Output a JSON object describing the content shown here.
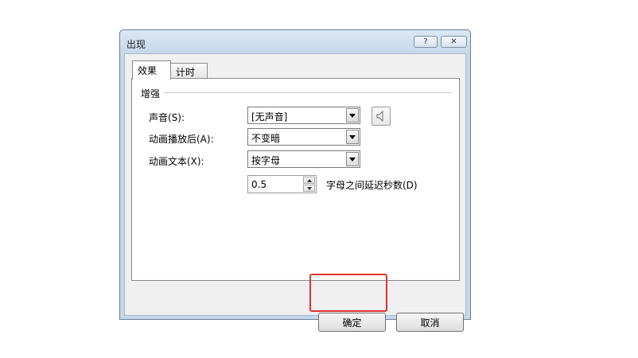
{
  "dialog": {
    "title": "出现",
    "help_glyph": "?",
    "close_glyph": "✕"
  },
  "tabs": [
    {
      "label": "效果",
      "active": true
    },
    {
      "label": "计时",
      "active": false
    }
  ],
  "group": {
    "title": "增强"
  },
  "fields": {
    "sound_label": "声音(S):",
    "sound_value": "[无声音]",
    "after_anim_label": "动画播放后(A):",
    "after_anim_value": "不变暗",
    "anim_text_label": "动画文本(X):",
    "anim_text_value": "按字母",
    "delay_value": "0.5",
    "delay_label": "字母之间延迟秒数(D)"
  },
  "buttons": {
    "ok": "确定",
    "cancel": "取消"
  },
  "colors": {
    "highlight": "#e0332e",
    "title_bar": "#c5d7ea"
  }
}
